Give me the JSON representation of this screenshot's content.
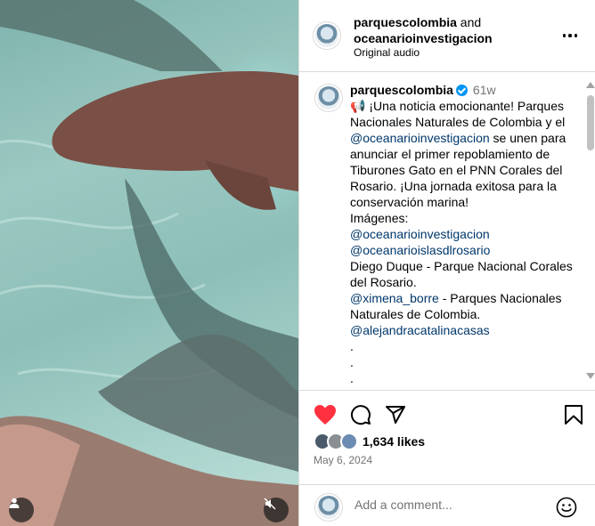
{
  "header": {
    "user1": "parquescolombia",
    "joiner": " and",
    "user2": "oceanarioinvestigacion",
    "audio": "Original audio"
  },
  "caption": {
    "username": "parquescolombia",
    "time": "61w",
    "emoji": "📢",
    "text1": " ¡Una noticia emocionante! Parques Nacionales Naturales de Colombia y el ",
    "mention1": "@oceanarioinvestigacion",
    "text2": " se unen para anunciar el primer repoblamiento de Tiburones Gato en el PNN Corales del Rosario. ¡Una jornada exitosa para la conservación marina!",
    "images_label": "Imágenes:",
    "mention2": "@oceanarioinvestigacion",
    "mention3": "@oceanarioislasdlrosario",
    "credit1": "Diego Duque - Parque Nacional Corales del Rosario.",
    "mention4": "@ximena_borre",
    "credit2": " - Parques Nacionales Naturales de Colombia.",
    "mention5": "@alejandracatalinacasas",
    "dot1": ".",
    "dot2": ".",
    "dot3": "."
  },
  "engagement": {
    "likes": "1,634 likes",
    "date": "May 6, 2024"
  },
  "comment_box": {
    "placeholder": "Add a comment..."
  },
  "icons": {
    "like": "heart-icon-filled",
    "comment": "comment-icon",
    "share": "send-icon",
    "save": "bookmark-icon",
    "more": "ellipsis-icon",
    "tags": "person-icon",
    "mute": "speaker-muted-icon",
    "emoji": "smiley-icon"
  },
  "colors": {
    "like": "#ff3040",
    "mention": "#00376b",
    "verified": "#0095f6",
    "muted_text": "#737373"
  }
}
